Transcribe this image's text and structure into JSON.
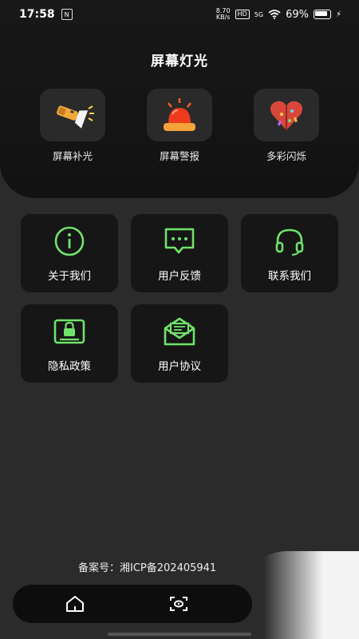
{
  "status_bar": {
    "time": "17:58",
    "net_speed_value": "8.70",
    "net_speed_unit": "KB/s",
    "hd": "HD",
    "network": "5G",
    "battery": "69%"
  },
  "header": {
    "title": "屏幕灯光"
  },
  "lights": [
    {
      "label": "屏幕补光",
      "icon": "flashlight-icon"
    },
    {
      "label": "屏幕警报",
      "icon": "alarm-siren-icon"
    },
    {
      "label": "多彩闪烁",
      "icon": "heart-confetti-icon"
    }
  ],
  "menu": [
    {
      "label": "关于我们",
      "icon": "info-icon"
    },
    {
      "label": "用户反馈",
      "icon": "feedback-icon"
    },
    {
      "label": "联系我们",
      "icon": "headset-icon"
    },
    {
      "label": "隐私政策",
      "icon": "privacy-lock-icon"
    },
    {
      "label": "用户协议",
      "icon": "agreement-mail-icon"
    }
  ],
  "footer": {
    "icp_text": "备案号：湘ICP备202405941"
  },
  "tabbar": {
    "tabs": [
      {
        "icon": "home-icon"
      },
      {
        "icon": "scan-icon"
      }
    ]
  },
  "colors": {
    "accent": "#6fe36a",
    "background": "#2b2b2b",
    "card": "#161616",
    "header": "#151515"
  }
}
